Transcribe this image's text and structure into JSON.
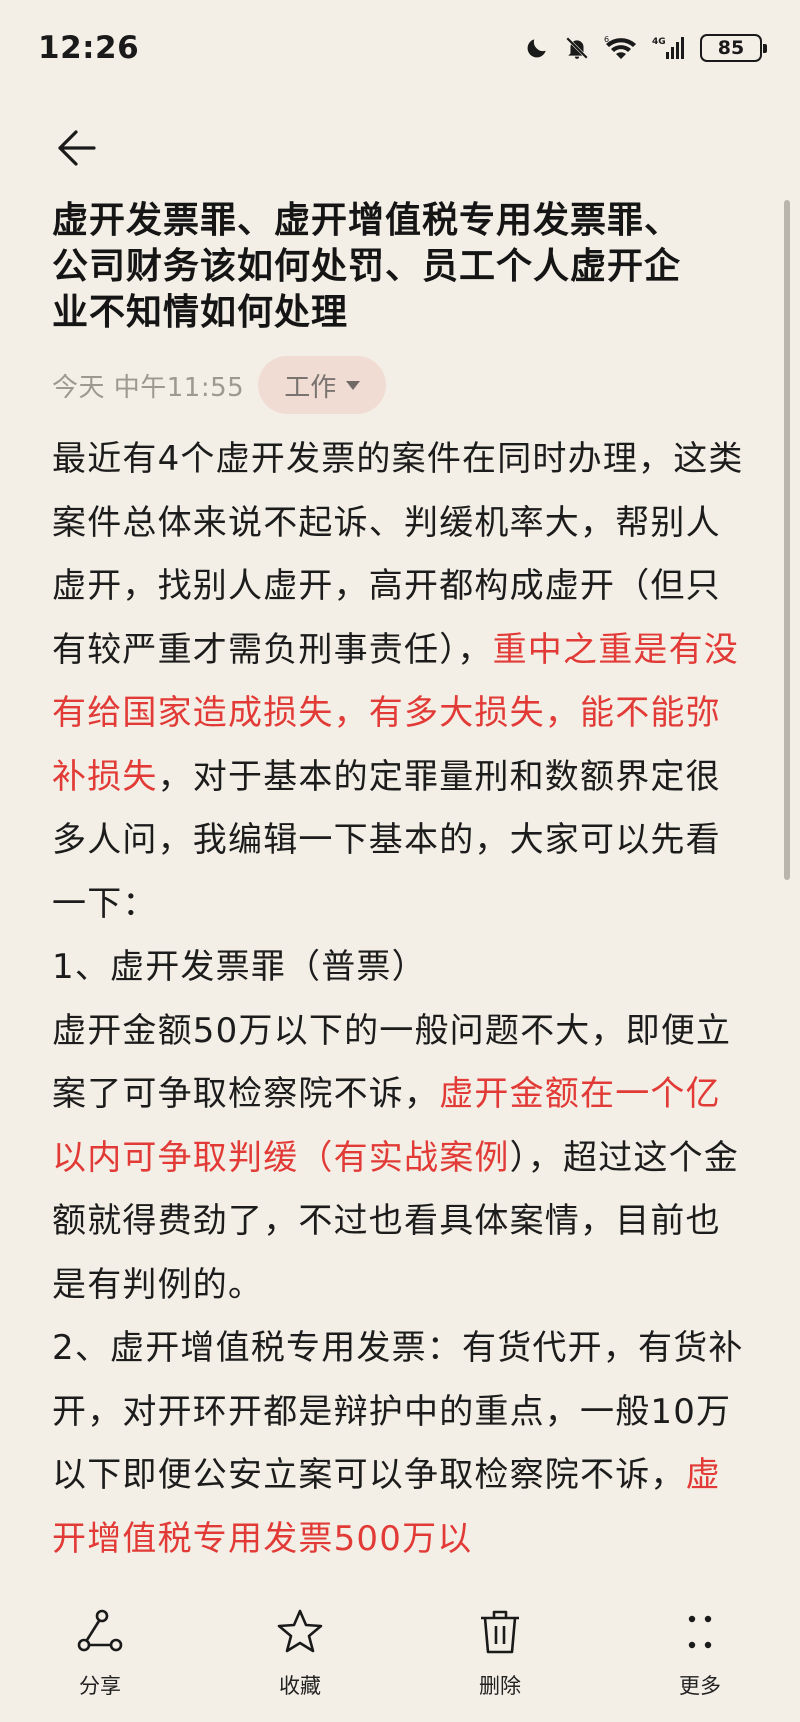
{
  "status_bar": {
    "time": "12:26",
    "battery": "85",
    "network": "4G"
  },
  "note": {
    "title": "虚开发票罪、虚开增值税专用发票罪、公司财务该如何处罚、员工个人虚开企业不知情如何处理",
    "date": "今天 中午11:55",
    "category": "工作",
    "paragraphs": [
      {
        "name": "paragraph-intro",
        "segments": [
          {
            "text": "最近有4个虚开发票的案件在同时办理，这类案件总体来说不起诉、判缓机率大，帮别人虚开，找别人虚开，高开都构成虚开（但只有较严重才需负刑事责任），",
            "highlight": false
          },
          {
            "text": "重中之重是有没有给国家造成损失，有多大损失，能不能弥补损失",
            "highlight": true
          },
          {
            "text": "，对于基本的定罪量刑和数额界定很多人问，我编辑一下基本的，大家可以先看一下：",
            "highlight": false
          }
        ]
      },
      {
        "name": "paragraph-heading-1",
        "segments": [
          {
            "text": "1、虚开发票罪（普票）",
            "highlight": false
          }
        ]
      },
      {
        "name": "paragraph-section-1",
        "segments": [
          {
            "text": "虚开金额50万以下的一般问题不大，即便立案了可争取检察院不诉，",
            "highlight": false
          },
          {
            "text": "虚开金额在一个亿以内可争取判缓（有实战案例",
            "highlight": true
          },
          {
            "text": "），超过这个金额就得费劲了，不过也看具体案情，目前也是有判例的。",
            "highlight": false
          }
        ]
      },
      {
        "name": "paragraph-section-2",
        "segments": [
          {
            "text": "2、虚开增值税专用发票：有货代开，有货补开，对开环开都是辩护中的重点，一般10万以下即便公安立案可以争取检察院不诉，",
            "highlight": false
          },
          {
            "text": "虚开增值税专用发票500万以",
            "highlight": true
          }
        ]
      }
    ]
  },
  "toolbar": [
    {
      "name": "share",
      "label": "分享",
      "icon": "share-icon"
    },
    {
      "name": "favorite",
      "label": "收藏",
      "icon": "star-icon"
    },
    {
      "name": "delete",
      "label": "删除",
      "icon": "trash-icon"
    },
    {
      "name": "more",
      "label": "更多",
      "icon": "more-icon"
    }
  ],
  "colors": {
    "background": "#f3efe6",
    "highlight": "#e23a36",
    "chip": "#f0dcd3"
  }
}
